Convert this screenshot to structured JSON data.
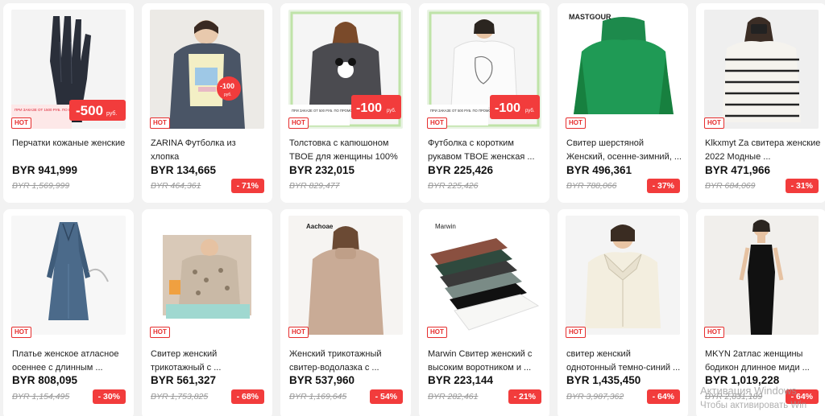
{
  "hot_label": "HOT",
  "colors": {
    "accent": "#f23c3c",
    "hot_border": "#e62e2e",
    "background": "#f2f2f2"
  },
  "products": [
    {
      "title": "Перчатки кожаные женские",
      "price": "BYR 941,999",
      "old_price": "BYR 1,569,999",
      "discount": "",
      "icon": "leather-gloves-image",
      "promo": "-500",
      "promo_sub": "руб.",
      "banner": "ПРИ ЗАКАЗЕ ОТ 1500 РУБ. ПО ПРОМОКОДУ ALIGALESB6"
    },
    {
      "title": "ZARINA Футболка из хлопка",
      "price": "BYR 134,665",
      "old_price": "BYR 464,361",
      "discount": "- 71%",
      "icon": "tshirt-model-image",
      "promo": "-100",
      "promo_sub": "руб."
    },
    {
      "title": "Толстовка с капюшоном TBOE для женщины 100% ...",
      "price": "BYR 232,015",
      "old_price": "BYR 829,477",
      "discount": "",
      "icon": "hoodie-model-image",
      "promo": "-100",
      "promo_sub": "руб.",
      "banner": "ПРИ ЗАКАЗЕ ОТ 500 РУБ. ПО ПРОМОКОДУ ALIGALE100"
    },
    {
      "title": "Футболка с коротким рукавом TBOE женская ...",
      "price": "BYR 225,426",
      "old_price": "BYR 225,426",
      "discount": "",
      "icon": "white-tshirt-model-image",
      "promo": "-100",
      "promo_sub": "руб.",
      "banner": "ПРИ ЗАКАЗЕ ОТ 500 РУБ. ПО ПРОМОКОДУ ALIGALE100"
    },
    {
      "title": "Свитер шерстяной Женский, осенне-зимний, ...",
      "price": "BYR 496,361",
      "old_price": "BYR 788,066",
      "discount": "- 37%",
      "icon": "green-sweater-image",
      "brand": "MASTGOUR"
    },
    {
      "title": "Klkxmyt Za свитера женские 2022 Модные ...",
      "price": "BYR 471,966",
      "old_price": "BYR 684,069",
      "discount": "- 31%",
      "icon": "striped-sweater-image"
    },
    {
      "title": "Платье женское атласное осеннее с длинным ...",
      "price": "BYR 808,095",
      "old_price": "BYR 1,154,495",
      "discount": "- 30%",
      "icon": "satin-dress-image"
    },
    {
      "title": "Свитер женский трикотажный с ...",
      "price": "BYR 561,327",
      "old_price": "BYR 1,753,825",
      "discount": "- 68%",
      "icon": "knit-sweater-image"
    },
    {
      "title": "Женский трикотажный свитер-водолазка с ...",
      "price": "BYR 537,960",
      "old_price": "BYR 1,169,645",
      "discount": "- 54%",
      "icon": "turtleneck-model-image",
      "brand": "Aachoae"
    },
    {
      "title": "Marwin Свитер женский с высоким воротником и ...",
      "price": "BYR 223,144",
      "old_price": "BYR 282,461",
      "discount": "- 21%",
      "icon": "folded-sweaters-image",
      "brand": "Marwin"
    },
    {
      "title": "свитер женский однотонный темно-синий ...",
      "price": "BYR 1,435,450",
      "old_price": "BYR 3,987,362",
      "discount": "- 64%",
      "icon": "cream-cardigan-image"
    },
    {
      "title": "MKYN 2атлас женщины бодикон длинное миди ...",
      "price": "BYR 1,019,228",
      "old_price": "BYR 2,831,189",
      "discount": "- 64%",
      "icon": "black-midi-dress-image"
    }
  ],
  "watermark": {
    "line1": "Активация Windows",
    "line2": "Чтобы активировать Win"
  }
}
